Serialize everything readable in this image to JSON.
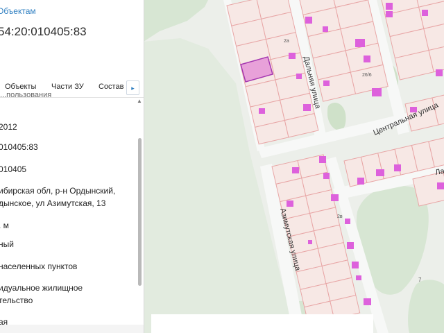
{
  "panel": {
    "back_link": "Объектам",
    "cadastral_number": "54:20:010405:83",
    "tabs": [
      "Объекты",
      "Части ЗУ",
      "Состав"
    ],
    "tab_next_icon": "▸",
    "scroll_up_icon": "▲",
    "cut_label": "...пользования",
    "fields": [
      {
        "lines": [
          "2012"
        ]
      },
      {
        "lines": [
          "010405:83"
        ]
      },
      {
        "lines": [
          "010405"
        ]
      },
      {
        "lines": [
          "ибирская обл, р-н Ордынский,",
          "дынское, ул Азимутская, 13"
        ]
      },
      {
        "lines": [
          ". м"
        ]
      },
      {
        "lines": [
          "ный"
        ]
      },
      {
        "lines": [
          "населенных пунктов"
        ]
      },
      {
        "lines": [
          "идуальное жилищное",
          "тельство"
        ]
      },
      {
        "lines": [
          "ая"
        ]
      }
    ]
  },
  "map": {
    "street_labels": [
      "Дальняя улица",
      "Центральная улица",
      "Азимутская улица",
      "Ла"
    ],
    "parcel_numbers": [
      "2a",
      "26/6",
      "2в",
      "7"
    ],
    "colors": {
      "background": "#ecefea",
      "greenery": "#d7e6d3",
      "parcel_line": "#e8a6a6",
      "parcel_fill": "#f7e8e5",
      "building": "#dd61dc",
      "selected_fill": "#e8a1d9",
      "selected_border": "#a436b0"
    }
  }
}
